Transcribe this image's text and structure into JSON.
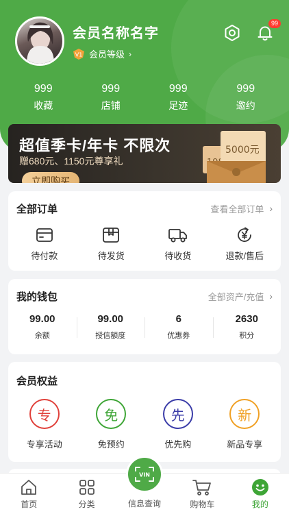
{
  "profile": {
    "member_name": "会员名称名字",
    "level_badge": "V1",
    "level_label": "会员等级",
    "level_arrow": "›"
  },
  "header": {
    "notification_count": "99"
  },
  "stats": [
    {
      "value": "999",
      "label": "收藏"
    },
    {
      "value": "999",
      "label": "店铺"
    },
    {
      "value": "999",
      "label": "足迹"
    },
    {
      "value": "999",
      "label": "邀约"
    }
  ],
  "banner": {
    "title": "超值季卡/年卡 不限次",
    "subtitle": "赠680元、1150元尊享礼",
    "button_label": "立即购买",
    "ticket_back": "198",
    "ticket_front": "5000元"
  },
  "orders": {
    "title": "全部订单",
    "link_label": "查看全部订单",
    "chevron": "›",
    "items": [
      {
        "label": "待付款",
        "icon": "wallet-icon"
      },
      {
        "label": "待发货",
        "icon": "package-icon"
      },
      {
        "label": "待收货",
        "icon": "truck-icon"
      },
      {
        "label": "退款/售后",
        "icon": "refund-icon"
      }
    ]
  },
  "wallet": {
    "title": "我的钱包",
    "link_label": "全部资产/充值",
    "chevron": "›",
    "items": [
      {
        "value": "99.00",
        "label": "余额"
      },
      {
        "value": "99.00",
        "label": "授信额度"
      },
      {
        "value": "6",
        "label": "优惠券"
      },
      {
        "value": "2630",
        "label": "积分"
      }
    ]
  },
  "rights": {
    "title": "会员权益",
    "items": [
      {
        "char": "专",
        "label": "专享活动",
        "color": "#e0403a"
      },
      {
        "char": "免",
        "label": "免预约",
        "color": "#3ea536"
      },
      {
        "char": "先",
        "label": "优先购",
        "color": "#3a3ca8"
      },
      {
        "char": "新",
        "label": "新品专享",
        "color": "#f0a024"
      }
    ]
  },
  "tabbar": {
    "items": [
      {
        "label": "首页",
        "icon": "home-icon"
      },
      {
        "label": "分类",
        "icon": "grid-icon"
      },
      {
        "label": "信息查询",
        "icon": "vin-scan-icon",
        "badge": "VIN"
      },
      {
        "label": "购物车",
        "icon": "cart-icon"
      },
      {
        "label": "我的",
        "icon": "smile-icon"
      }
    ]
  },
  "colors": {
    "brand_green": "#4faa47",
    "active_tab": "#3ea536",
    "badge_red": "#ff3b30"
  }
}
